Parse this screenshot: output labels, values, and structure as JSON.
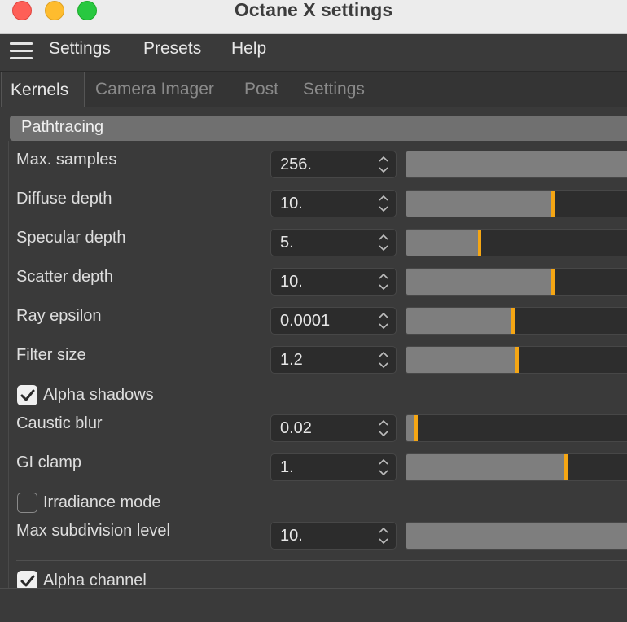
{
  "window": {
    "title": "Octane X settings"
  },
  "menubar": {
    "items": [
      "Settings",
      "Presets",
      "Help"
    ]
  },
  "tabs": [
    "Kernels",
    "Camera Imager",
    "Post",
    "Settings"
  ],
  "section": {
    "title": "Pathtracing"
  },
  "params": [
    {
      "label": "Max. samples",
      "value": "256.",
      "level": 1.0
    },
    {
      "label": "Diffuse depth",
      "value": "10.",
      "level": 0.66
    },
    {
      "label": "Specular depth",
      "value": "5.",
      "level": 0.33
    },
    {
      "label": "Scatter depth",
      "value": "10.",
      "level": 0.66
    },
    {
      "label": "Ray epsilon",
      "value": "0.0001",
      "level": 0.48
    },
    {
      "label": "Filter size",
      "value": "1.2",
      "level": 0.5
    },
    {
      "label": "Caustic blur",
      "value": "0.02",
      "level": 0.04
    },
    {
      "label": "GI clamp",
      "value": "1.",
      "level": 0.72
    },
    {
      "label": "Max subdivision level",
      "value": "10.",
      "level": 1.0
    }
  ],
  "checkboxes": [
    {
      "label": "Alpha shadows",
      "checked": true
    },
    {
      "label": "Irradiance mode",
      "checked": false
    },
    {
      "label": "Alpha channel",
      "checked": true
    }
  ],
  "colors": {
    "accent": "#f5a614",
    "slider_fill": "#7e7e7e"
  }
}
